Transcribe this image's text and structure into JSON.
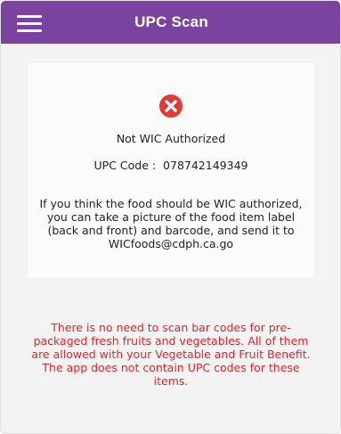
{
  "header": {
    "title": "UPC Scan",
    "menu_icon": "hamburger-menu-icon"
  },
  "result": {
    "icon": "error-x-icon",
    "icon_color": "#e53935",
    "status": "Not WIC Authorized",
    "upc_label": "UPC Code :",
    "upc_value": "078742149349",
    "info": "If you think the food should be WIC authorized, you can take a picture of the food item label (back and front) and barcode, and send it to WICfoods@cdph.ca.go"
  },
  "notice": {
    "text": "There is no need to scan bar codes for pre-packaged fresh fruits and vegetables. All of them are allowed with your Vegetable and Fruit Benefit. The app does not contain UPC codes for these items."
  },
  "colors": {
    "header_bg": "#7a43a0",
    "notice_text": "#e0262b"
  }
}
